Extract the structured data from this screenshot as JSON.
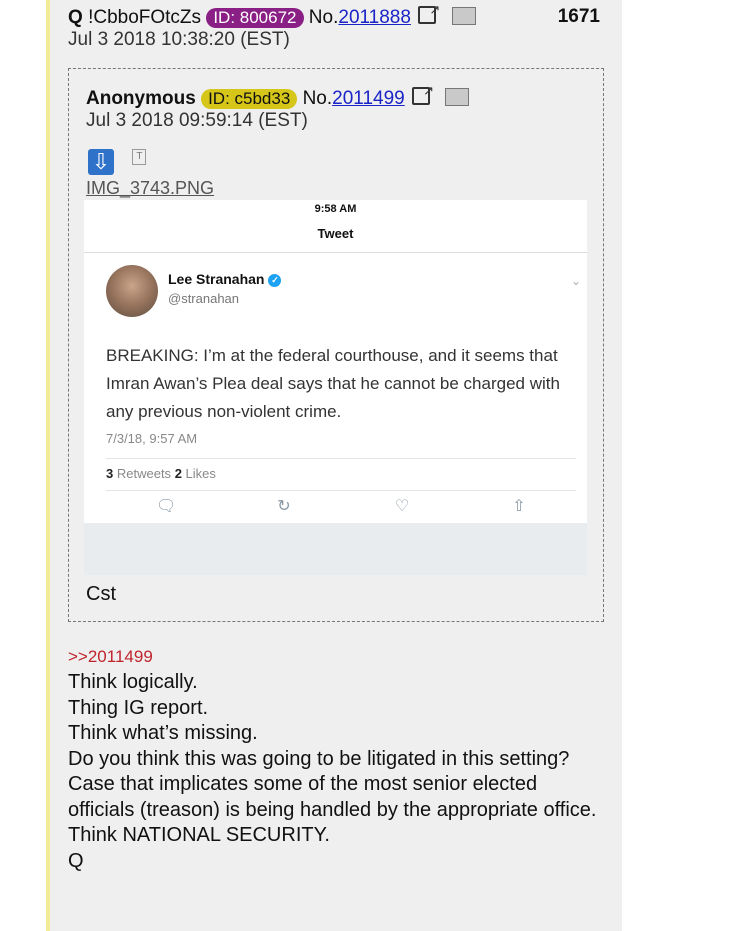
{
  "post": {
    "author": "Q",
    "tripcode": "!CbboFOtcZs",
    "id_badge": "ID: 800672",
    "no_prefix": "No.",
    "number": "2011888",
    "post_index": "1671",
    "date": "Jul 3 2018 10:38:20 (EST)"
  },
  "quoted": {
    "author": "Anonymous",
    "id_badge": "ID: c5bd33",
    "no_prefix": "No.",
    "number": "2011499",
    "date": "Jul 3 2018 09:59:14 (EST)",
    "file_icon_letter": "T",
    "filename": "IMG_3743.PNG",
    "caption": "Cst",
    "tweet": {
      "status_time": "9:58 AM",
      "screen_title": "Tweet",
      "display_name": "Lee Stranahan",
      "handle": "@stranahan",
      "text": "BREAKING: I’m at the federal courthouse, and it seems that Imran Awan’s Plea deal says that he cannot be charged with any previous non-violent crime.",
      "timestamp": "7/3/18, 9:57 AM",
      "retweets_count": "3",
      "retweets_label": "Retweets",
      "likes_count": "2",
      "likes_label": "Likes"
    }
  },
  "reply": {
    "backlink": ">>2011499",
    "lines": [
      "Think logically.",
      "Thing IG report.",
      "Think what’s missing.",
      "Do you think this was going to be litigated in this setting?",
      "Case that implicates some of the most senior elected officials (treason) is being handled by the appropriate office.",
      "Think NATIONAL SECURITY.",
      "Q"
    ]
  },
  "colors": {
    "post_bg": "#efefef",
    "id_badge_q": "#8a1f86",
    "id_badge_anon": "#d6c61a",
    "link_blue": "#1a24c7",
    "backlink_red": "#c0242c"
  }
}
